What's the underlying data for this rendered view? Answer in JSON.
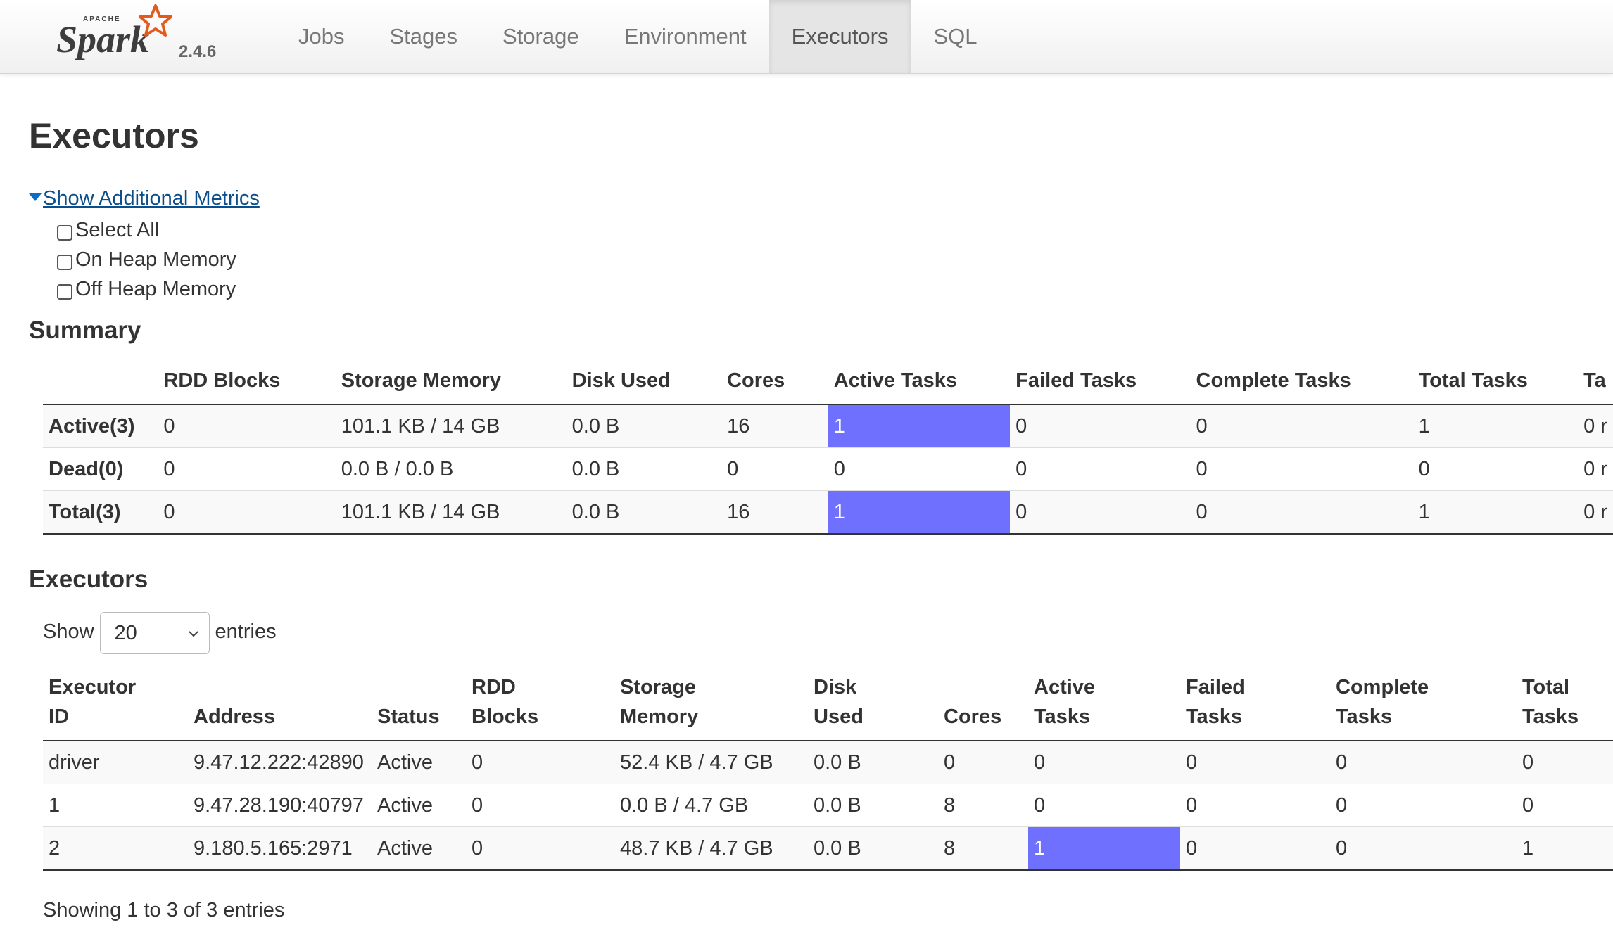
{
  "header": {
    "brand_small": "APACHE",
    "brand_name": "Spark",
    "version": "2.4.6",
    "tabs": [
      {
        "label": "Jobs"
      },
      {
        "label": "Stages"
      },
      {
        "label": "Storage"
      },
      {
        "label": "Environment"
      },
      {
        "label": "Executors",
        "active": true
      },
      {
        "label": "SQL"
      }
    ],
    "accent_color": "#e25a1c"
  },
  "page": {
    "title": "Executors",
    "metrics_toggle": "Show Additional Metrics",
    "metrics_options": [
      {
        "label": "Select All",
        "checked": false
      },
      {
        "label": "On Heap Memory",
        "checked": false
      },
      {
        "label": "Off Heap Memory",
        "checked": false
      }
    ]
  },
  "summary": {
    "heading": "Summary",
    "columns": [
      "",
      "RDD Blocks",
      "Storage Memory",
      "Disk Used",
      "Cores",
      "Active Tasks",
      "Failed Tasks",
      "Complete Tasks",
      "Total Tasks",
      "Ta"
    ],
    "rows": [
      {
        "label": "Active(3)",
        "rdd": "0",
        "storage": "101.1 KB / 14 GB",
        "disk": "0.0 B",
        "cores": "16",
        "active": "1",
        "failed": "0",
        "complete": "0",
        "total": "1",
        "more": "0 r"
      },
      {
        "label": "Dead(0)",
        "rdd": "0",
        "storage": "0.0 B / 0.0 B",
        "disk": "0.0 B",
        "cores": "0",
        "active": "0",
        "failed": "0",
        "complete": "0",
        "total": "0",
        "more": "0 r"
      },
      {
        "label": "Total(3)",
        "rdd": "0",
        "storage": "101.1 KB / 14 GB",
        "disk": "0.0 B",
        "cores": "16",
        "active": "1",
        "failed": "0",
        "complete": "0",
        "total": "1",
        "more": "0 r"
      }
    ],
    "highlight_color": "#7070ff"
  },
  "executors": {
    "heading": "Executors",
    "show_label": "Show",
    "page_size": "20",
    "entries_label": "entries",
    "columns": [
      {
        "line1": "Executor",
        "line2": "ID"
      },
      {
        "line1": "",
        "line2": "Address"
      },
      {
        "line1": "",
        "line2": "Status"
      },
      {
        "line1": "RDD",
        "line2": "Blocks"
      },
      {
        "line1": "Storage",
        "line2": "Memory"
      },
      {
        "line1": "Disk",
        "line2": "Used"
      },
      {
        "line1": "",
        "line2": "Cores"
      },
      {
        "line1": "Active",
        "line2": "Tasks"
      },
      {
        "line1": "Failed",
        "line2": "Tasks"
      },
      {
        "line1": "Complete",
        "line2": "Tasks"
      },
      {
        "line1": "Total",
        "line2": "Tasks"
      }
    ],
    "rows": [
      {
        "id": "driver",
        "address": "9.47.12.222:42890",
        "status": "Active",
        "rdd": "0",
        "storage": "52.4 KB / 4.7 GB",
        "disk": "0.0 B",
        "cores": "0",
        "active": "0",
        "failed": "0",
        "complete": "0",
        "total": "0"
      },
      {
        "id": "1",
        "address": "9.47.28.190:40797",
        "status": "Active",
        "rdd": "0",
        "storage": "0.0 B / 4.7 GB",
        "disk": "0.0 B",
        "cores": "8",
        "active": "0",
        "failed": "0",
        "complete": "0",
        "total": "0"
      },
      {
        "id": "2",
        "address": "9.180.5.165:2971",
        "status": "Active",
        "rdd": "0",
        "storage": "48.7 KB / 4.7 GB",
        "disk": "0.0 B",
        "cores": "8",
        "active": "1",
        "failed": "0",
        "complete": "0",
        "total": "1"
      }
    ],
    "footer": "Showing 1 to 3 of 3 entries"
  }
}
